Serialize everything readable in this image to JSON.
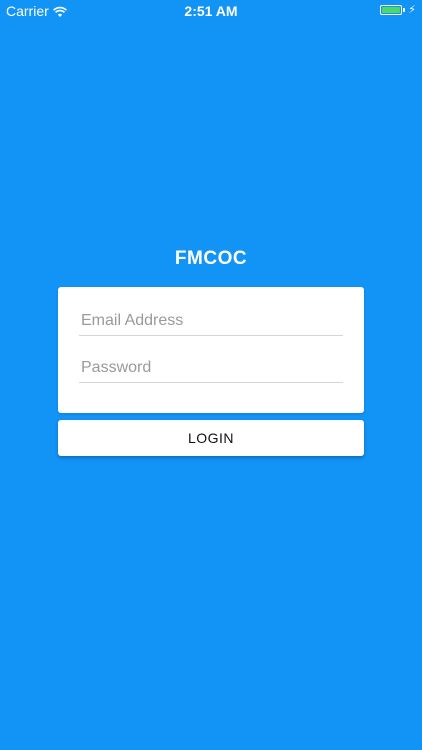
{
  "status_bar": {
    "carrier": "Carrier",
    "time": "2:51 AM",
    "charging_symbol": "⚡",
    "battery_color": "#4cd964"
  },
  "app": {
    "title": "FMCOC",
    "background_color": "#1293f6"
  },
  "login_form": {
    "email": {
      "placeholder": "Email Address",
      "value": ""
    },
    "password": {
      "placeholder": "Password",
      "value": ""
    },
    "login_label": "LOGIN"
  }
}
